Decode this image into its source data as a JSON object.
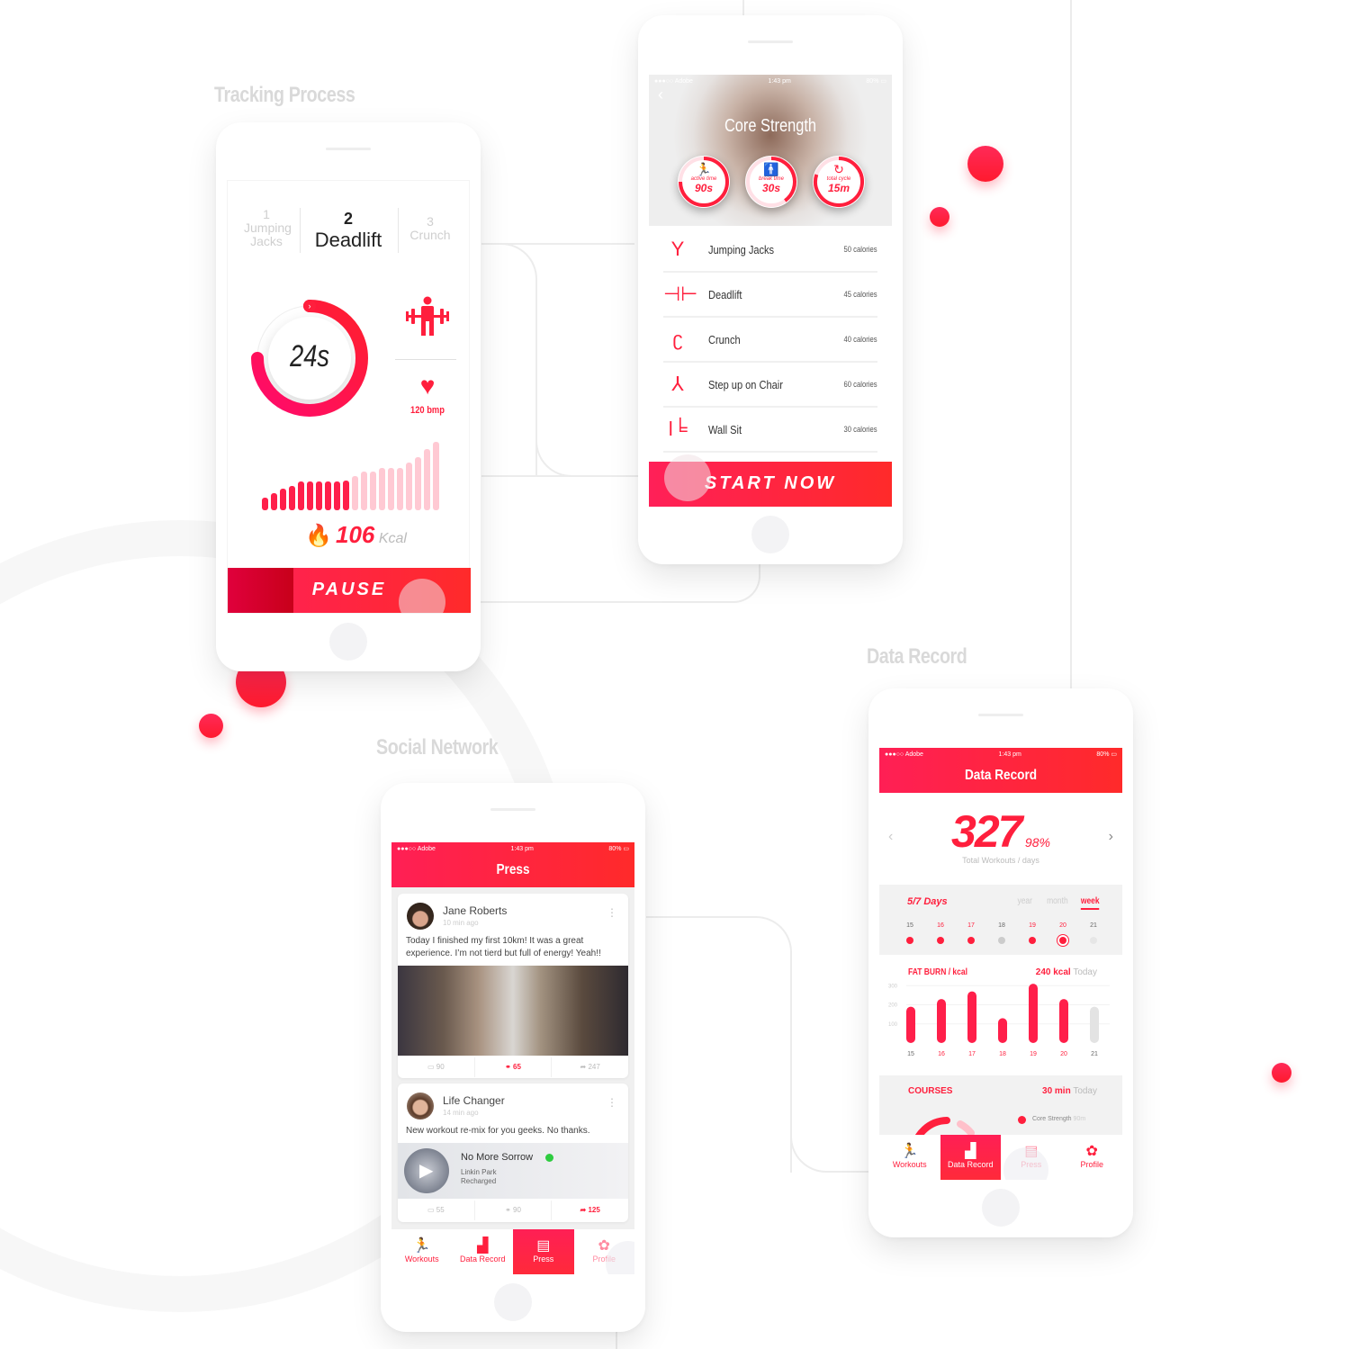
{
  "sections": {
    "tracking": "Tracking Process",
    "social": "Social Network",
    "data_record": "Data Record"
  },
  "colors": {
    "accent": "#ff1f3d",
    "accent_pink": "#ff1f55",
    "label_gray": "#d9d9d9"
  },
  "tracking": {
    "tabs": [
      {
        "num": "1",
        "label": "Jumping Jacks"
      },
      {
        "num": "2",
        "label": "Deadlift"
      },
      {
        "num": "3",
        "label": "Crunch"
      }
    ],
    "active_tab": 1,
    "timer": "24s",
    "timer_progress": 0.75,
    "exercise_icon": "deadlift-icon",
    "heart_rate": "120 bmp",
    "calories_value": "106",
    "calories_unit": "Kcal",
    "intensity_bars": [
      0.18,
      0.25,
      0.32,
      0.36,
      0.42,
      0.42,
      0.42,
      0.42,
      0.42,
      0.44,
      0.5,
      0.56,
      0.56,
      0.62,
      0.62,
      0.62,
      0.7,
      0.78,
      0.9,
      1.0
    ],
    "intensity_done": 10,
    "pause_label": "PAUSE",
    "pause_progress": 0.27
  },
  "core": {
    "status": {
      "carrier": "●●●○○ Adobe",
      "time": "1:43 pm",
      "battery": "80%"
    },
    "back": "‹",
    "title": "Core Strength",
    "rings": [
      {
        "icon": "running-icon",
        "glyph": "🏃",
        "label": "active time",
        "value": "90s",
        "progress": 0.75
      },
      {
        "icon": "standing-icon",
        "glyph": "🚹",
        "label": "break time",
        "value": "30s",
        "progress": 0.4
      },
      {
        "icon": "cycle-icon",
        "glyph": "↻",
        "label": "total cycle",
        "value": "15m",
        "progress": 0.8
      }
    ],
    "exercises": [
      {
        "name": "Jumping Jacks",
        "calories": "50 calories",
        "icon": "jumping-jacks-icon",
        "glyph": "Y"
      },
      {
        "name": "Deadlift",
        "calories": "45 calories",
        "icon": "deadlift-icon",
        "glyph": "⊣⊢"
      },
      {
        "name": "Crunch",
        "calories": "40 calories",
        "icon": "crunch-icon",
        "glyph": "ʗ"
      },
      {
        "name": "Step up on Chair",
        "calories": "60 calories",
        "icon": "step-up-icon",
        "glyph": "⅄"
      },
      {
        "name": "Wall Sit",
        "calories": "30 calories",
        "icon": "wall-sit-icon",
        "glyph": "ǀ╘"
      }
    ],
    "start_label": "START NOW"
  },
  "press": {
    "status": {
      "carrier": "●●●○○ Adobe",
      "time": "1:43 pm",
      "battery": "80%"
    },
    "title": "Press",
    "posts": [
      {
        "user": "Jane Roberts",
        "time": "10 min ago",
        "text": "Today I finished my first 10km! It was a great experience. I’m not tierd but full of energy! Yeah!!",
        "comments": "90",
        "likes": "65",
        "shares": "247",
        "active": "likes"
      },
      {
        "user": "Life Changer",
        "time": "14 min ago",
        "text": "New workout re-mix for you geeks. No thanks.",
        "track": {
          "title": "No More Sorrow",
          "artist": "Linkin Park",
          "album": "Recharged"
        },
        "comments": "55",
        "likes": "90",
        "shares": "125",
        "active": "shares"
      }
    ],
    "nav": [
      {
        "label": "Workouts",
        "icon": "workouts-icon",
        "glyph": "🏃"
      },
      {
        "label": "Data Record",
        "icon": "data-record-icon",
        "glyph": "▟"
      },
      {
        "label": "Press",
        "icon": "press-icon",
        "glyph": "▤"
      },
      {
        "label": "Profile",
        "icon": "profile-icon",
        "glyph": "✿"
      }
    ],
    "active_nav": 2
  },
  "data": {
    "status": {
      "carrier": "●●●○○ Adobe",
      "time": "1:43 pm",
      "battery": "80%"
    },
    "title": "Data Record",
    "big_number": "327",
    "percent": "98%",
    "caption": "Total Workouts / days",
    "days_summary": "5/7 Days",
    "periods": [
      "year",
      "month",
      "week"
    ],
    "active_period": 2,
    "days": [
      {
        "d": "15",
        "state": "done"
      },
      {
        "d": "16",
        "state": "done"
      },
      {
        "d": "17",
        "state": "done"
      },
      {
        "d": "18",
        "state": "missed"
      },
      {
        "d": "19",
        "state": "done"
      },
      {
        "d": "20",
        "state": "today"
      },
      {
        "d": "21",
        "state": "future"
      }
    ],
    "courses_label": "COURSES",
    "courses_today_value": "30 min",
    "courses_today_label": "Today",
    "courses_legend": {
      "name": "Core Strength",
      "value": "90m"
    },
    "nav": [
      {
        "label": "Workouts",
        "icon": "workouts-icon",
        "glyph": "🏃"
      },
      {
        "label": "Data Record",
        "icon": "data-record-icon",
        "glyph": "▟"
      },
      {
        "label": "Press",
        "icon": "press-icon",
        "glyph": "▤"
      },
      {
        "label": "Profile",
        "icon": "profile-icon",
        "glyph": "✿"
      }
    ],
    "active_nav": 1
  },
  "chart_data": {
    "type": "bar",
    "title": "FAT BURN / kcal",
    "summary_value": "240 kcal",
    "summary_label": "Today",
    "categories": [
      "15",
      "16",
      "17",
      "18",
      "19",
      "20",
      "21"
    ],
    "values": [
      190,
      230,
      270,
      130,
      310,
      230,
      190
    ],
    "highlight": [
      false,
      true,
      true,
      true,
      true,
      true,
      false
    ],
    "future": [
      false,
      false,
      false,
      false,
      false,
      false,
      true
    ],
    "yticks": [
      100,
      200,
      300
    ],
    "ylim": [
      0,
      320
    ],
    "grid": true,
    "xlabel": "",
    "ylabel": ""
  }
}
